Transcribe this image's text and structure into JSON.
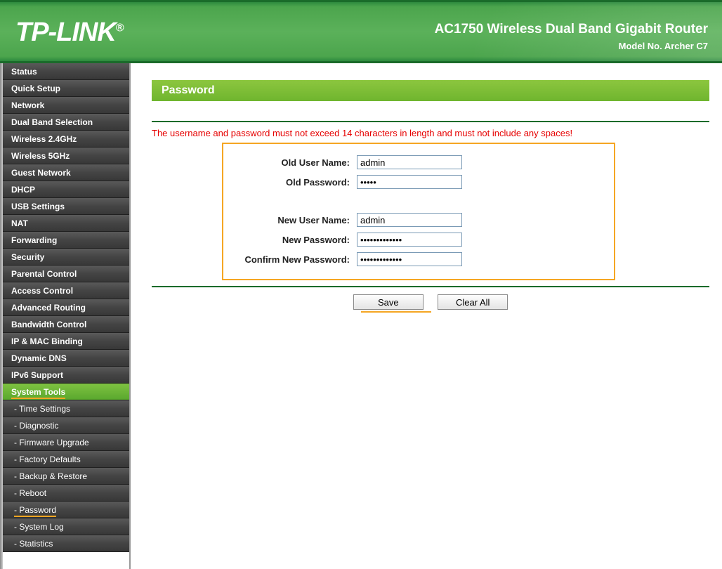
{
  "header": {
    "logo": "TP-LINK",
    "logo_reg": "®",
    "title": "AC1750 Wireless Dual Band Gigabit Router",
    "model": "Model No. Archer C7"
  },
  "nav": {
    "items": [
      {
        "label": "Status",
        "type": "main"
      },
      {
        "label": "Quick Setup",
        "type": "main"
      },
      {
        "label": "Network",
        "type": "main"
      },
      {
        "label": "Dual Band Selection",
        "type": "main"
      },
      {
        "label": "Wireless 2.4GHz",
        "type": "main"
      },
      {
        "label": "Wireless 5GHz",
        "type": "main"
      },
      {
        "label": "Guest Network",
        "type": "main"
      },
      {
        "label": "DHCP",
        "type": "main"
      },
      {
        "label": "USB Settings",
        "type": "main"
      },
      {
        "label": "NAT",
        "type": "main"
      },
      {
        "label": "Forwarding",
        "type": "main"
      },
      {
        "label": "Security",
        "type": "main"
      },
      {
        "label": "Parental Control",
        "type": "main"
      },
      {
        "label": "Access Control",
        "type": "main"
      },
      {
        "label": "Advanced Routing",
        "type": "main"
      },
      {
        "label": "Bandwidth Control",
        "type": "main"
      },
      {
        "label": "IP & MAC Binding",
        "type": "main"
      },
      {
        "label": "Dynamic DNS",
        "type": "main"
      },
      {
        "label": "IPv6 Support",
        "type": "main"
      },
      {
        "label": "System Tools",
        "type": "main",
        "active": true
      },
      {
        "label": "- Time Settings",
        "type": "sub"
      },
      {
        "label": "- Diagnostic",
        "type": "sub"
      },
      {
        "label": "- Firmware Upgrade",
        "type": "sub"
      },
      {
        "label": "- Factory Defaults",
        "type": "sub"
      },
      {
        "label": "- Backup & Restore",
        "type": "sub"
      },
      {
        "label": "- Reboot",
        "type": "sub"
      },
      {
        "label": "- Password",
        "type": "sub",
        "subactive": true
      },
      {
        "label": "- System Log",
        "type": "sub"
      },
      {
        "label": "- Statistics",
        "type": "sub"
      }
    ]
  },
  "page": {
    "title": "Password",
    "warning": "The username and password must not exceed 14 characters in length and must not include any spaces!",
    "form": {
      "old_user_label": "Old User Name:",
      "old_user_value": "admin",
      "old_pass_label": "Old Password:",
      "old_pass_value": "•••••",
      "new_user_label": "New User Name:",
      "new_user_value": "admin",
      "new_pass_label": "New Password:",
      "new_pass_value": "•••••••••••••",
      "confirm_pass_label": "Confirm New Password:",
      "confirm_pass_value": "•••••••••••••"
    },
    "buttons": {
      "save": "Save",
      "clear": "Clear All"
    }
  }
}
